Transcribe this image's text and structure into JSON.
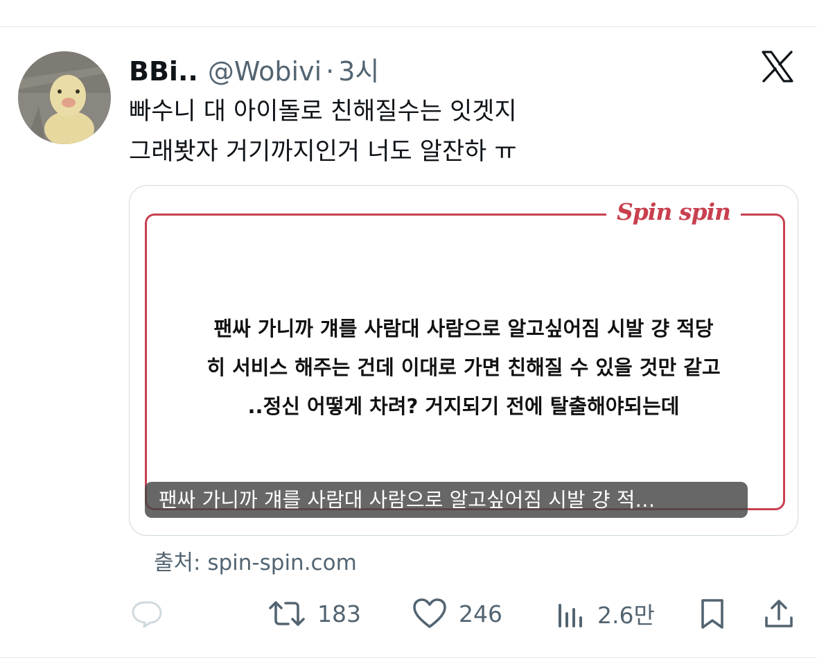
{
  "tweet": {
    "display_name": "BBi..",
    "handle": "@Wobivi",
    "separator": "·",
    "time": "3시",
    "text_lines": [
      "빠수니 대 아이돌로 친해질수는 잇겟지",
      "그래봣자 거기까지인거 너도 알잔하 ㅠ"
    ]
  },
  "card": {
    "brand": "Spin spin",
    "quote_lines": [
      "팬싸 가니까 걔를 사람대 사람으로 알고싶어짐 시발 걍 적당",
      "히 서비스 해주는 건데 이대로 가면 친해질 수 있을 것만 같고",
      "..정신 어떻게 차려? 거지되기 전에 탈출해야되는데"
    ],
    "caption": "팬싸 가니까 걔를 사람대 사람으로 알고싶어짐 시발 걍 적…",
    "accent_color": "#c8404f"
  },
  "source": "출처: spin-spin.com",
  "actions": {
    "reply_icon": "reply-icon",
    "retweet_count": "183",
    "like_count": "246",
    "views_count": "2.6만"
  },
  "colors": {
    "text_primary": "#0f1419",
    "text_secondary": "#536471",
    "border": "#cfd9de"
  }
}
